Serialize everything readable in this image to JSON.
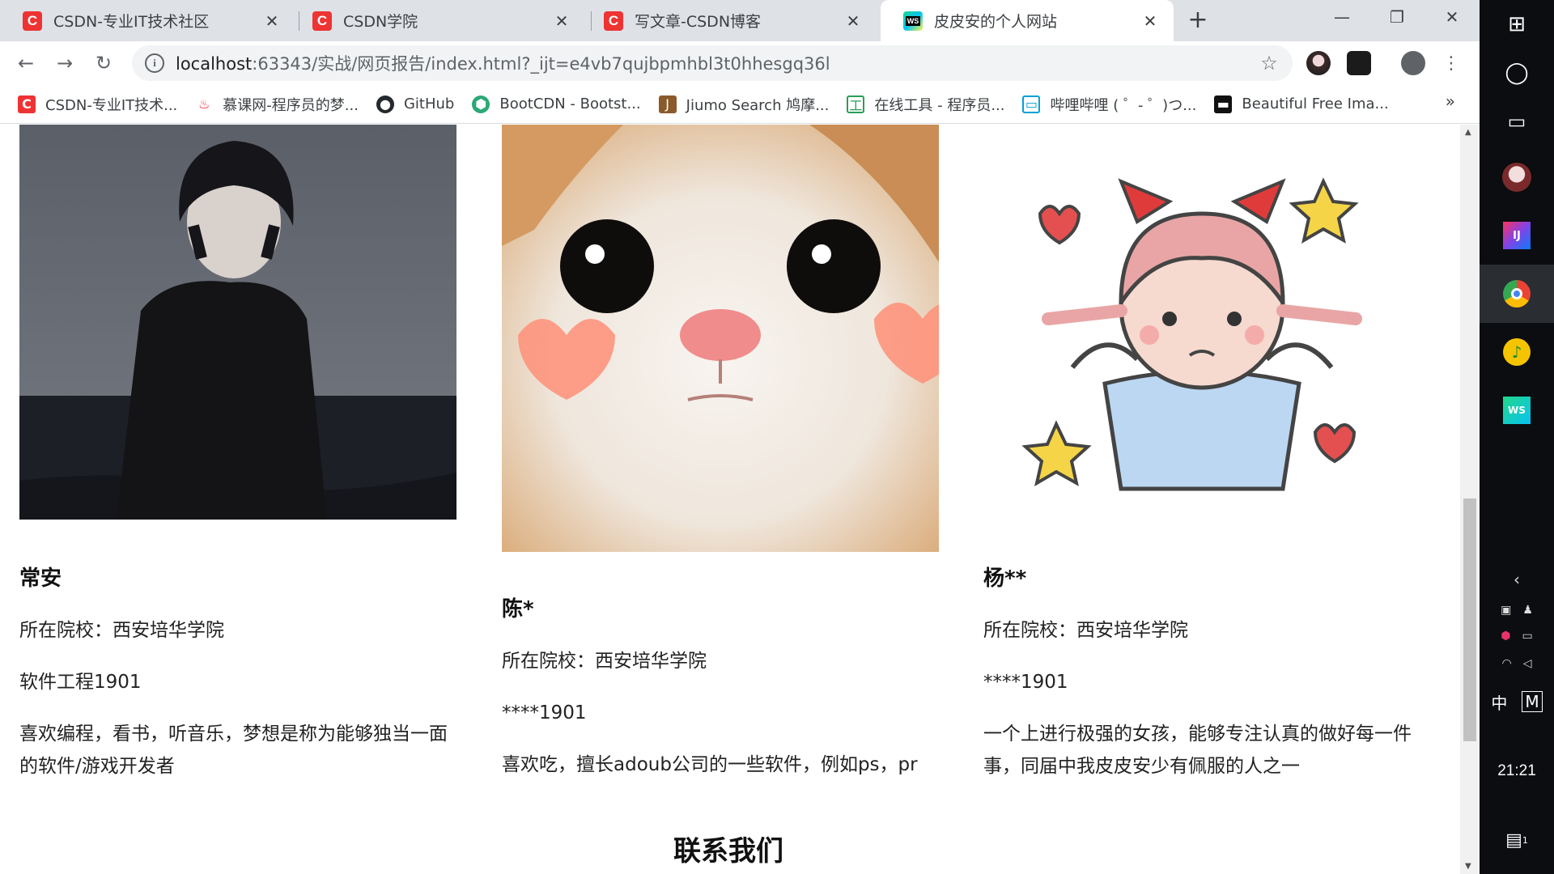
{
  "tabs": [
    {
      "title": "CSDN-专业IT技术社区",
      "favicon": "csdn-icon",
      "active": false
    },
    {
      "title": "CSDN学院",
      "favicon": "csdn-icon",
      "active": false
    },
    {
      "title": "写文章-CSDN博客",
      "favicon": "csdn-icon",
      "active": false
    },
    {
      "title": "皮皮安的个人网站",
      "favicon": "webstorm-icon",
      "active": true
    }
  ],
  "toolbar": {
    "url_host": "localhost",
    "url_path": ":63343/实战/网页报告/index.html?_ijt=e4vb7qujbpmhbl3t0hhesgq36l"
  },
  "bookmarks": [
    {
      "label": "CSDN-专业IT技术...",
      "icon": "csdn-icon"
    },
    {
      "label": "慕课网-程序员的梦...",
      "icon": "flame-icon"
    },
    {
      "label": "GitHub",
      "icon": "github-icon"
    },
    {
      "label": "BootCDN - Bootst...",
      "icon": "bootcdn-icon"
    },
    {
      "label": "Jiumo Search 鸠摩...",
      "icon": "jiumo-icon"
    },
    {
      "label": "在线工具 - 程序员...",
      "icon": "tools-icon"
    },
    {
      "label": "哔哩哔哩 ( ゜- ゜)つ...",
      "icon": "bilibili-icon"
    },
    {
      "label": "Beautiful Free Ima...",
      "icon": "unsplash-icon"
    }
  ],
  "members": [
    {
      "name": "常安",
      "school": "所在院校：西安培华学院",
      "major": "软件工程1901",
      "bio": "喜欢编程，看书，听音乐，梦想是称为能够独当一面的软件/游戏开发者"
    },
    {
      "name": "陈*",
      "school": "所在院校：西安培华学院",
      "major": "****1901",
      "bio": "喜欢吃，擅长adoub公司的一些软件，例如ps，pr"
    },
    {
      "name": "杨**",
      "school": "所在院校：西安培华学院",
      "major": "****1901",
      "bio": "一个上进行极强的女孩，能够专注认真的做好每一件事，同届中我皮皮安少有佩服的人之一"
    }
  ],
  "contact_heading": "联系我们",
  "taskbar": {
    "clock": "21:21",
    "ime": "中",
    "ime_mode": "M",
    "notification_count": "1"
  }
}
